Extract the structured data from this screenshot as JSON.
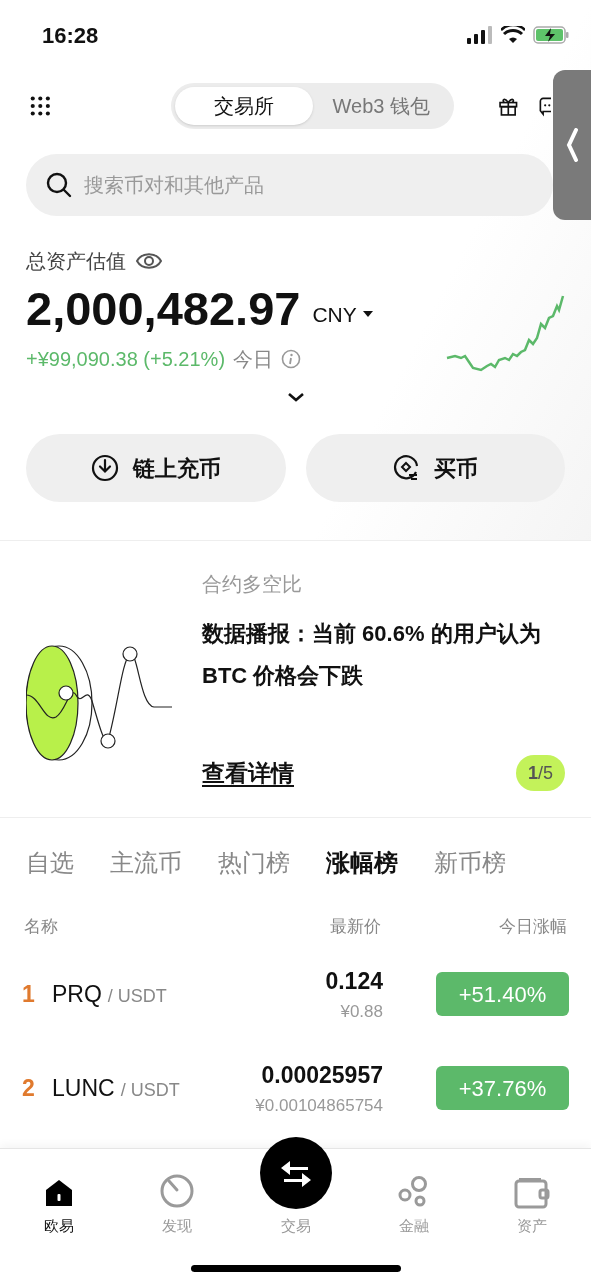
{
  "status_bar": {
    "time": "16:28"
  },
  "header": {
    "tabs": [
      {
        "label": "交易所",
        "selected": true
      },
      {
        "label": "Web3 钱包",
        "selected": false
      }
    ]
  },
  "search": {
    "placeholder": "搜索币对和其他产品"
  },
  "assets": {
    "label": "总资产估值",
    "value": "2,000,482.97",
    "currency": "CNY",
    "change": "+¥99,090.38 (+5.21%)",
    "period": "今日"
  },
  "actions": [
    {
      "label": "链上充币",
      "kind": "deposit"
    },
    {
      "label": "买币",
      "kind": "buy"
    }
  ],
  "promo": {
    "category": "合约多空比",
    "text": "数据播报：当前 60.6% 的用户认为 BTC 价格会下跌",
    "link": "查看详情",
    "pager": "**1**/5"
  },
  "market": {
    "tabs": [
      {
        "label": "自选",
        "selected": false
      },
      {
        "label": "主流币",
        "selected": false
      },
      {
        "label": "热门榜",
        "selected": false
      },
      {
        "label": "涨幅榜",
        "selected": true
      },
      {
        "label": "新币榜",
        "selected": false
      }
    ],
    "columns": [
      "名称",
      "最新价",
      "今日涨幅"
    ],
    "rows": [
      {
        "rank": "1",
        "base": "PRQ",
        "quote": "/ USDT",
        "price": "0.124",
        "price_cny": "¥0.88",
        "change": "+51.40%"
      },
      {
        "rank": "2",
        "base": "LUNC",
        "quote": "/ USDT",
        "price": "0.00025957",
        "price_cny": "¥0.00104865754",
        "change": "+37.76%"
      }
    ]
  },
  "nav": [
    {
      "label": "欧易",
      "kind": "home",
      "selected": true
    },
    {
      "label": "发现",
      "kind": "discover",
      "selected": false
    },
    {
      "label": "交易",
      "kind": "trade",
      "selected": false
    },
    {
      "label": "金融",
      "kind": "finance",
      "selected": false
    },
    {
      "label": "资产",
      "kind": "assets",
      "selected": false
    }
  ]
}
